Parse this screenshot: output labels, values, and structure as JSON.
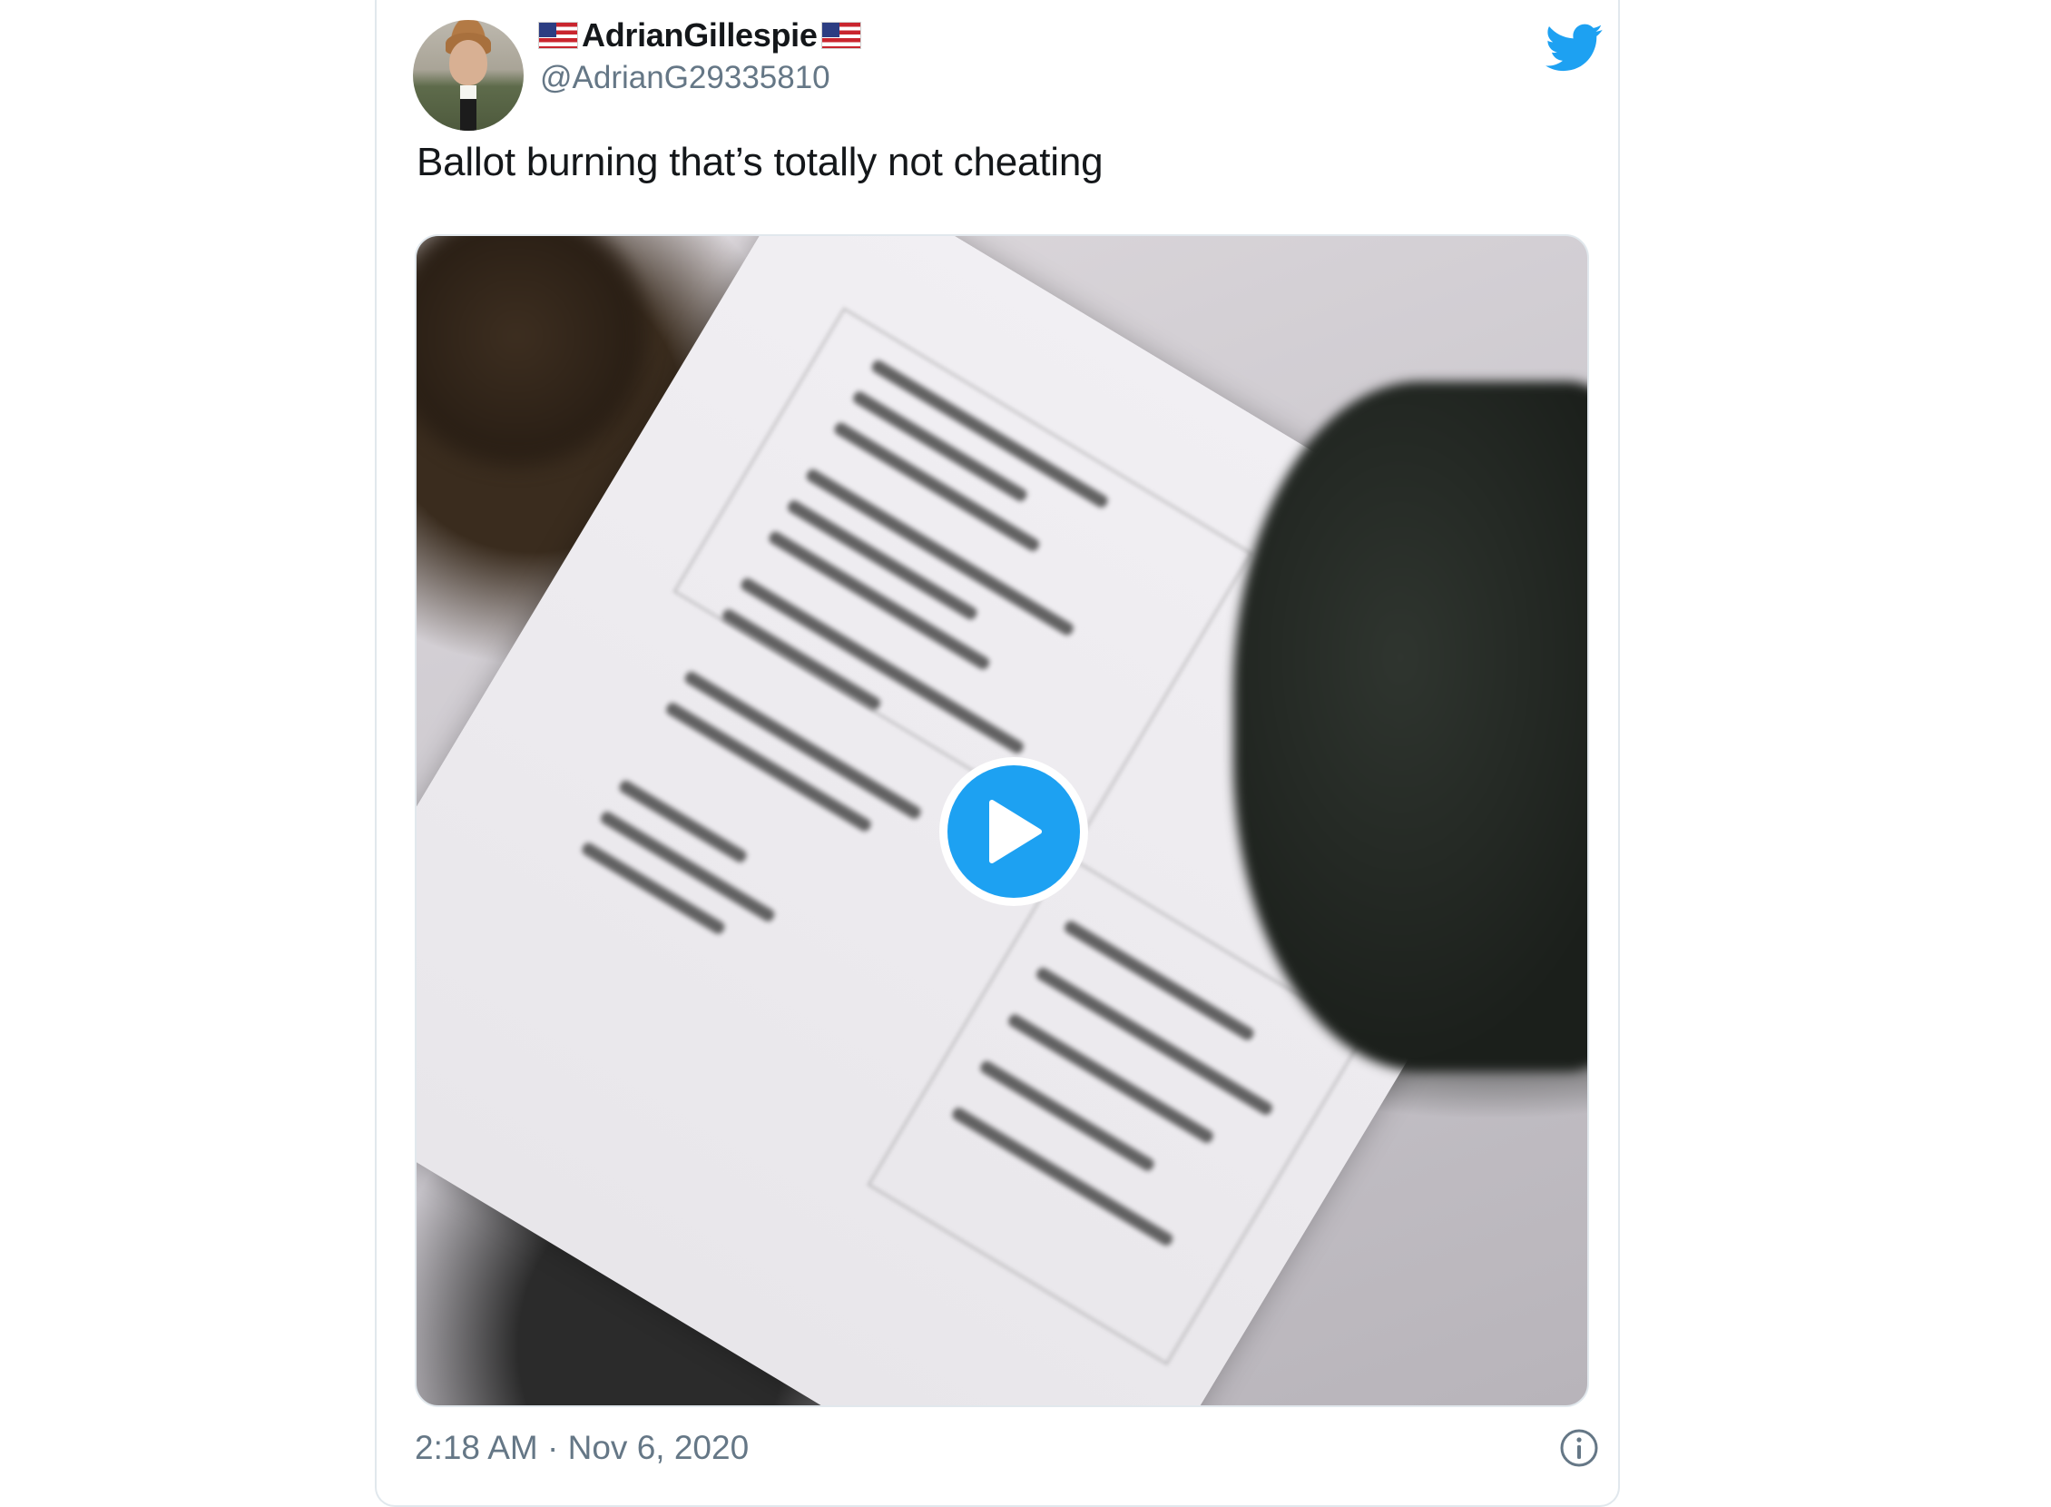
{
  "tweet": {
    "display_name": "AdrianGillespie",
    "handle": "@AdrianG29335810",
    "text": "Ballot burning that’s totally not cheating",
    "timestamp": "2:18 AM · Nov 6, 2020",
    "name_flag_icon": "us-flag-icon",
    "brand_icon": "twitter-bird-icon",
    "media_control_icon": "play-icon",
    "info_icon": "info-icon"
  },
  "colors": {
    "brand": "#1DA1F2",
    "text_primary": "#14171A",
    "text_secondary": "#657786",
    "border": "#E1E8ED"
  }
}
